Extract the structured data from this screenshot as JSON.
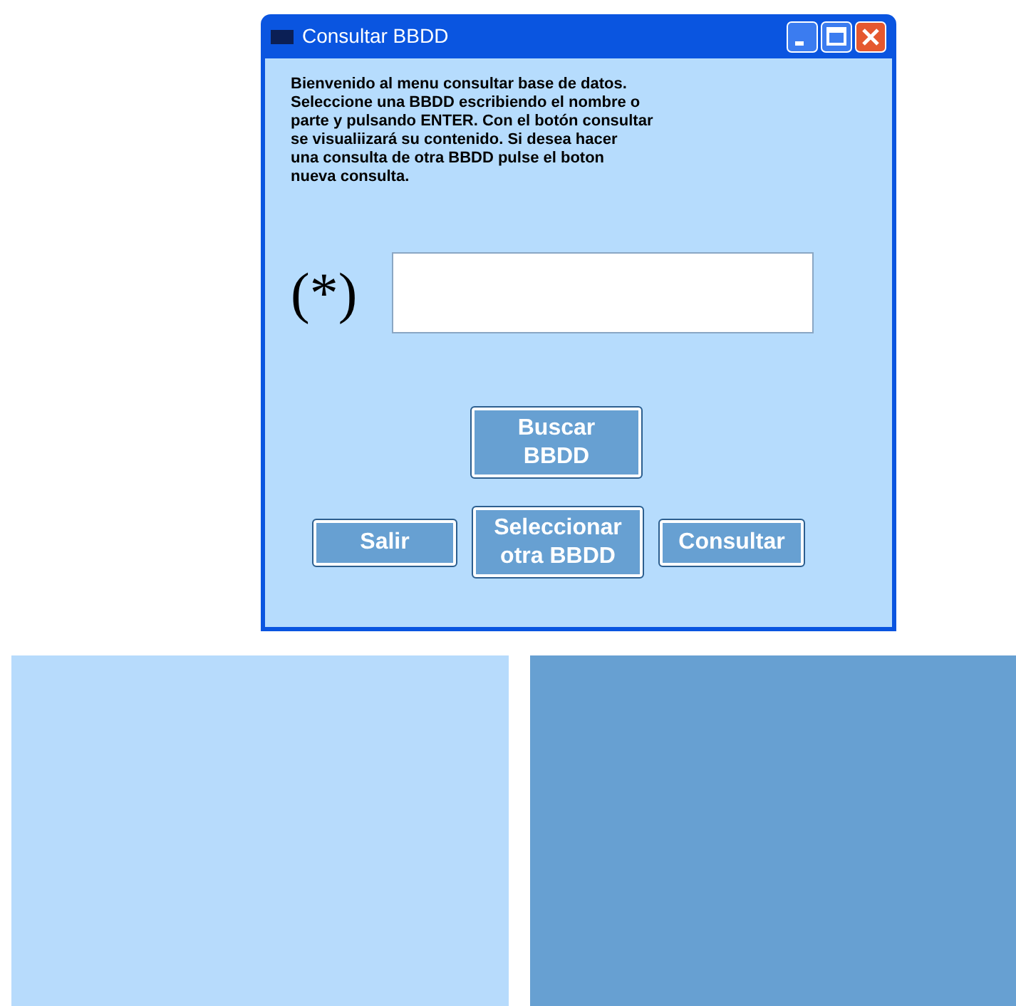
{
  "window": {
    "title": "Consultar BBDD"
  },
  "intro": "Bienvenido al menu consultar base de datos.\nSeleccione una BBDD escribiendo el nombre o\nparte y pulsando ENTER. Con el botón consultar\nse visualiizará su contenido. Si desea hacer\nuna consulta de otra BBDD pulse el boton\nnueva consulta.",
  "field": {
    "label": "(*)"
  },
  "buttons": [
    {
      "label": "Buscar BBDD",
      "kind": "search"
    },
    {
      "label": "Salir",
      "kind": "row"
    },
    {
      "label": "Seleccionar otra BBDD",
      "kind": "row"
    },
    {
      "label": "Consultar",
      "kind": "row"
    }
  ],
  "swatches": [
    {
      "color": "#b7dbfc"
    },
    {
      "color": "#67a0d2"
    }
  ]
}
